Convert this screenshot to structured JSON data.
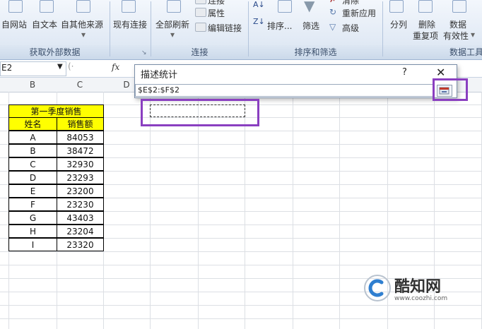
{
  "ribbon": {
    "buttons": {
      "from_web": "自网站",
      "from_text": "自文本",
      "from_other": "自其他来源",
      "existing_connections": "现有连接",
      "refresh_all": "全部刷新",
      "connections_top": "连接",
      "properties": "属性",
      "edit_links": "编辑链接",
      "sort": "排序...",
      "filter": "筛选",
      "clear": "清除",
      "reapply": "重新应用",
      "advanced": "高级",
      "text_to_columns": "分列",
      "remove_duplicates_1": "删除",
      "remove_duplicates_2": "重复项",
      "data_validation_1": "数据",
      "data_validation_2": "有效性"
    },
    "groups": {
      "get_external": "获取外部数据",
      "connections": "连接",
      "sort_filter": "排序和筛选",
      "data_tools": "数据工具"
    }
  },
  "formula_bar": {
    "name_box": "E2",
    "fx": "fx"
  },
  "columns": [
    "B",
    "C",
    "D"
  ],
  "table": {
    "title": "第一季度销售",
    "headers": [
      "姓名",
      "销售额"
    ],
    "rows": [
      [
        "A",
        "84053"
      ],
      [
        "B",
        "38472"
      ],
      [
        "C",
        "32930"
      ],
      [
        "D",
        "23293"
      ],
      [
        "E",
        "23200"
      ],
      [
        "F",
        "23230"
      ],
      [
        "G",
        "43403"
      ],
      [
        "H",
        "23204"
      ],
      [
        "I",
        "23320"
      ]
    ]
  },
  "dialog": {
    "title": "描述统计",
    "help": "?",
    "close": "✕",
    "range_value": "$E$2:$F$2"
  },
  "watermark": {
    "name": "酷知网",
    "url": "www.coozhi.com"
  },
  "colors": {
    "highlight": "#8a3fc0",
    "header_fill": "#ffff00"
  }
}
